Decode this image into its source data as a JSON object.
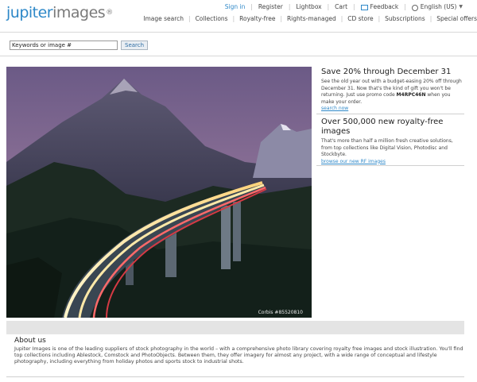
{
  "logo": {
    "part1": "jupiter",
    "part2": "images",
    "mark": "®"
  },
  "util_nav": {
    "signin": "Sign in",
    "register": "Register",
    "lightbox": "Lightbox",
    "cart": "Cart",
    "feedback": "Feedback",
    "language": "English (US)"
  },
  "main_nav": [
    "Image search",
    "Collections",
    "Royalty-free",
    "Rights-managed",
    "CD store",
    "Subscriptions",
    "Special offers"
  ],
  "search": {
    "value": "Keywords or image #",
    "button": "Search"
  },
  "hero": {
    "credit": "Corbis #85520810"
  },
  "promos": [
    {
      "title": "Save 20% through December 31",
      "body_before": "See the old year out with a budget-easing 20% off through December 31. Now that's the kind of gift you won't be returning. Just use promo code ",
      "code": "M4RPC46N",
      "body_after": " when you make your order.",
      "link": "search now"
    },
    {
      "title": "Over 500,000 new royalty-free images",
      "body": "That's more than half a million fresh creative solutions, from top collections like Digital Vision, Photodisc and Stockbyte.",
      "link": "browse our new RF images"
    }
  ],
  "about": {
    "title": "About us",
    "body": "Jupiter Images is one of the leading suppliers of stock photography in the world – with a comprehensive photo library covering royalty free images and stock illustration. You'll find top collections including Ablestock, Comstock and PhotoObjects. Between them, they offer imagery for almost any project, with a wide range of conceptual and lifestyle photography, including everything from holiday photos and sports stock to industrial shots."
  },
  "colors": {
    "brand_blue": "#2e88c8",
    "logo_gray": "#7a7a7a",
    "about_bar": "#e4e4e4"
  }
}
